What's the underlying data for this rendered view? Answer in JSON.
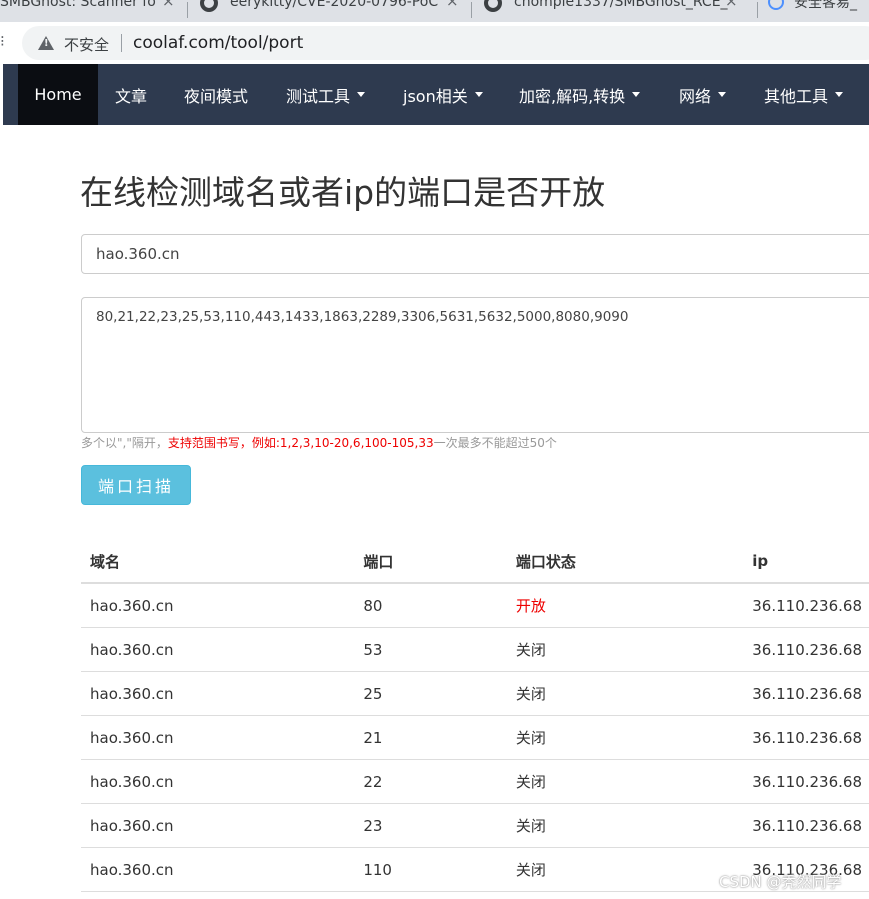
{
  "browser": {
    "tabs": [
      {
        "title": "SMBGhost: Scanner fo"
      },
      {
        "title": "eerykitty/CVE-2020-0796-PoC"
      },
      {
        "title": "chompie1337/SMBGhost_RCE_"
      },
      {
        "title": "安全客易_"
      }
    ],
    "tab_close_glyph": "×",
    "security_label": "不安全",
    "url": "coolaf.com/tool/port"
  },
  "navbar": {
    "items": [
      {
        "label": "Home",
        "dropdown": false
      },
      {
        "label": "文章",
        "dropdown": false
      },
      {
        "label": "夜间模式",
        "dropdown": false
      },
      {
        "label": "测试工具",
        "dropdown": true
      },
      {
        "label": "json相关",
        "dropdown": true
      },
      {
        "label": "加密,解码,转换",
        "dropdown": true
      },
      {
        "label": "网络",
        "dropdown": true
      },
      {
        "label": "其他工具",
        "dropdown": true
      }
    ],
    "background": "#2e3a4f",
    "active_background": "#0b0d12"
  },
  "page": {
    "title": "在线检测域名或者ip的端口是否开放",
    "domain_value": "hao.360.cn",
    "ports_value": "80,21,22,23,25,53,110,443,1433,1863,2289,3306,5631,5632,5000,8080,9090",
    "hint_gray_1": "多个以\",\"隔开，",
    "hint_red": "支持范围书写，例如:1,2,3,10-20,6,100-105,33",
    "hint_gray_2": "一次最多不能超过50个",
    "scan_button": "端口扫描",
    "button_color": "#5bc0de"
  },
  "table": {
    "headers": [
      "域名",
      "端口",
      "端口状态",
      "ip"
    ],
    "rows": [
      {
        "domain": "hao.360.cn",
        "port": "80",
        "status": "开放",
        "ip": "36.110.236.68"
      },
      {
        "domain": "hao.360.cn",
        "port": "53",
        "status": "关闭",
        "ip": "36.110.236.68"
      },
      {
        "domain": "hao.360.cn",
        "port": "25",
        "status": "关闭",
        "ip": "36.110.236.68"
      },
      {
        "domain": "hao.360.cn",
        "port": "21",
        "status": "关闭",
        "ip": "36.110.236.68"
      },
      {
        "domain": "hao.360.cn",
        "port": "22",
        "status": "关闭",
        "ip": "36.110.236.68"
      },
      {
        "domain": "hao.360.cn",
        "port": "23",
        "status": "关闭",
        "ip": "36.110.236.68"
      },
      {
        "domain": "hao.360.cn",
        "port": "110",
        "status": "关闭",
        "ip": "36.110.236.68"
      }
    ],
    "open_color": "#e00000"
  },
  "watermark": "CSDN @秃然同学"
}
